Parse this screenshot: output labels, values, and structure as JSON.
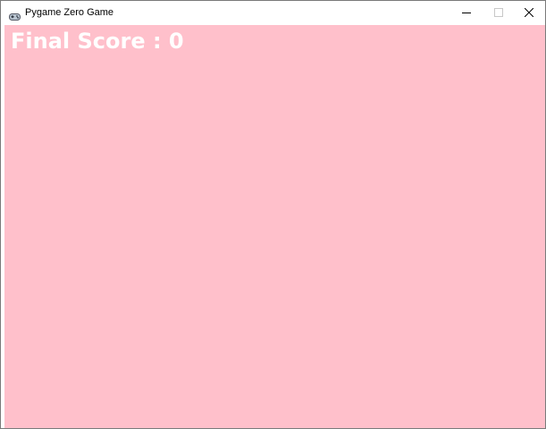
{
  "window": {
    "title": "Pygame Zero Game",
    "icon": "gamepad-icon",
    "controls": {
      "minimize": "minimize-icon",
      "maximize": "maximize-icon",
      "close": "close-icon"
    }
  },
  "game": {
    "background_color": "#ffc0cb",
    "text_color": "#ffffff",
    "score_text": "Final Score : 0"
  }
}
